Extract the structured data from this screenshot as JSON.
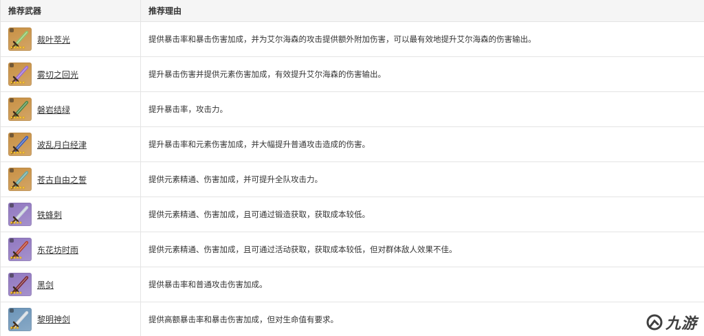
{
  "header": {
    "col_weapon": "推荐武器",
    "col_reason": "推荐理由"
  },
  "rows": [
    {
      "name": "裁叶萃光",
      "reason": "提供暴击率和暴击伤害加成，并为艾尔海森的攻击提供额外附加伤害，可以最有效地提升艾尔海森的伤害输出。",
      "rarity": 5,
      "bg": "#c89043",
      "blade": "#8fc46a",
      "stars": "★★★★★"
    },
    {
      "name": "雾切之回光",
      "reason": "提升暴击伤害并提供元素伤害加成，有效提升艾尔海森的伤害输出。",
      "rarity": 5,
      "bg": "#c89043",
      "blade": "#9a6bd1",
      "stars": "★★★★★"
    },
    {
      "name": "磐岩结绿",
      "reason": "提升暴击率，攻击力。",
      "rarity": 5,
      "bg": "#c89043",
      "blade": "#4f8a4a",
      "stars": "★★★★★"
    },
    {
      "name": "波乱月白经津",
      "reason": "提升暴击率和元素伤害加成，并大幅提升普通攻击造成的伤害。",
      "rarity": 5,
      "bg": "#c89043",
      "blade": "#3f5fb8",
      "stars": "★★★★★"
    },
    {
      "name": "苍古自由之誓",
      "reason": "提供元素精通、伤害加成，并可提升全队攻击力。",
      "rarity": 5,
      "bg": "#c89043",
      "blade": "#6aa7a0",
      "stars": "★★★★★"
    },
    {
      "name": "铁蜂刺",
      "reason": "提供元素精通、伤害加成，且可通过锻造获取，获取成本较低。",
      "rarity": 4,
      "bg": "#9077c0",
      "blade": "#c9d2dc",
      "stars": "★★★★"
    },
    {
      "name": "东花坊时雨",
      "reason": "提供元素精通、伤害加成，且可通过活动获取，获取成本较低，但对群体敌人效果不佳。",
      "rarity": 4,
      "bg": "#9077c0",
      "blade": "#b5412d",
      "stars": "★★★★"
    },
    {
      "name": "黑剑",
      "reason": "提供暴击率和普通攻击伤害加成。",
      "rarity": 4,
      "bg": "#9077c0",
      "blade": "#7b2a34",
      "stars": "★★★★"
    },
    {
      "name": "黎明神剑",
      "reason": "提供高额暴击率和暴击伤害加成，但对生命值有要求。",
      "rarity": 3,
      "bg": "#6b94b8",
      "blade": "#d8dde2",
      "stars": "★★★"
    }
  ],
  "watermark": {
    "icon": "jiuyou-logo-icon",
    "text": "九游"
  }
}
